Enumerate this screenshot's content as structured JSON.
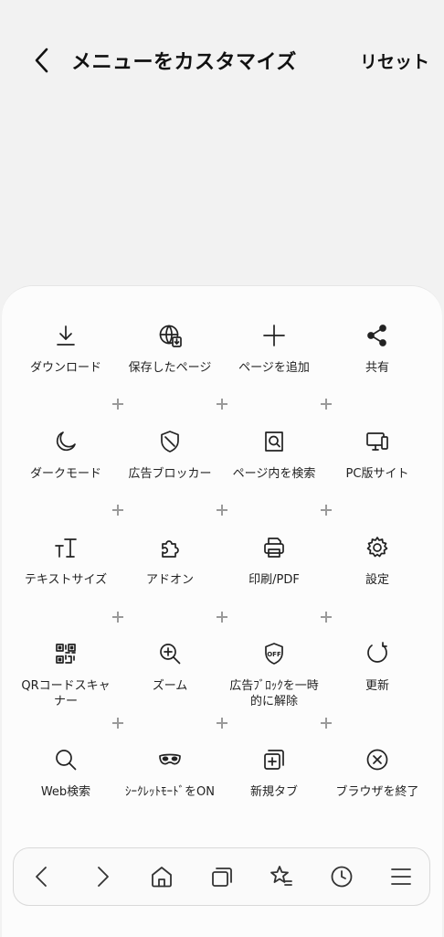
{
  "header": {
    "title": "メニューをカスタマイズ",
    "reset_label": "リセット"
  },
  "menu_items": [
    {
      "label": "ダウンロード",
      "icon": "download-icon"
    },
    {
      "label": "保存したページ",
      "icon": "saved-pages-icon"
    },
    {
      "label": "ページを追加",
      "icon": "plus-icon"
    },
    {
      "label": "共有",
      "icon": "share-icon"
    },
    {
      "label": "ダークモード",
      "icon": "moon-icon"
    },
    {
      "label": "広告ブロッカー",
      "icon": "shield-icon"
    },
    {
      "label": "ページ内を検索",
      "icon": "find-in-page-icon"
    },
    {
      "label": "PC版サイト",
      "icon": "desktop-icon"
    },
    {
      "label": "テキストサイズ",
      "icon": "text-size-icon"
    },
    {
      "label": "アドオン",
      "icon": "puzzle-icon"
    },
    {
      "label": "印刷/PDF",
      "icon": "printer-icon"
    },
    {
      "label": "設定",
      "icon": "gear-icon"
    },
    {
      "label": "QRコードスキャナー",
      "icon": "qr-code-icon"
    },
    {
      "label": "ズーム",
      "icon": "zoom-in-icon"
    },
    {
      "label": "広告ﾌﾞﾛｯｸを一時的に解除",
      "icon": "ad-block-off-icon",
      "icon_text": "OFF"
    },
    {
      "label": "更新",
      "icon": "refresh-icon"
    },
    {
      "label": "Web検索",
      "icon": "search-icon"
    },
    {
      "label": "ｼｰｸﾚｯﾄﾓｰﾄﾞをON",
      "icon": "mask-icon"
    },
    {
      "label": "新規タブ",
      "icon": "new-tab-icon"
    },
    {
      "label": "ブラウザを終了",
      "icon": "close-circle-icon"
    }
  ],
  "navbar": [
    {
      "icon": "back-arrow-icon"
    },
    {
      "icon": "forward-arrow-icon"
    },
    {
      "icon": "home-icon"
    },
    {
      "icon": "tabs-icon"
    },
    {
      "icon": "bookmark-star-icon"
    },
    {
      "icon": "history-clock-icon"
    },
    {
      "icon": "menu-icon"
    }
  ]
}
